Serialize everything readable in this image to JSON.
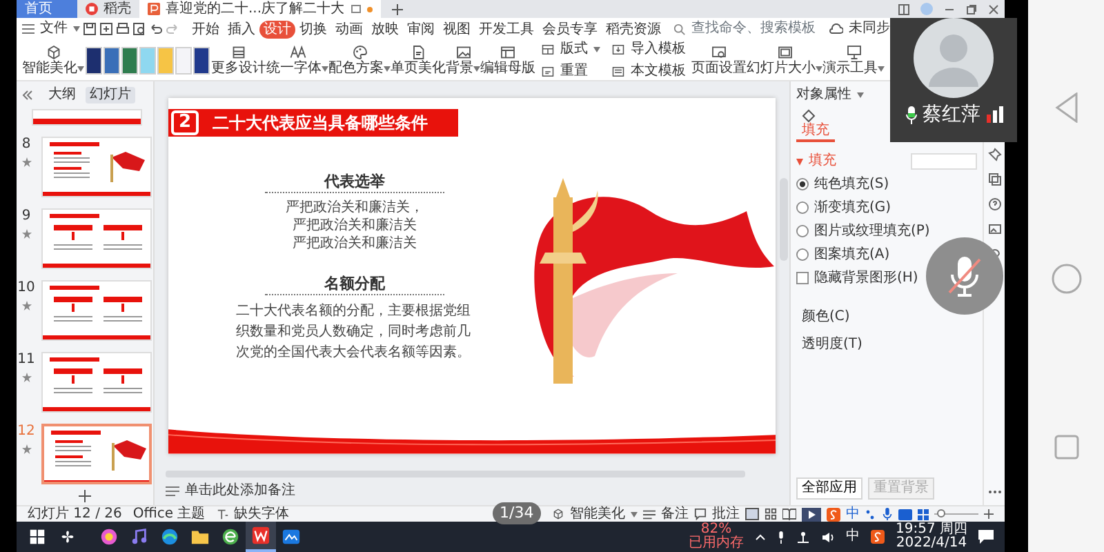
{
  "title_tabs": [
    {
      "label": "首页",
      "kind": "home",
      "selected": false
    },
    {
      "label": "稻壳",
      "kind": "docer",
      "selected": false
    },
    {
      "label": "喜迎党的二十...庆了解二十大",
      "kind": "presentation",
      "selected": true
    }
  ],
  "menu": {
    "file": "文件",
    "tabs": [
      {
        "label": "开始",
        "selected": false
      },
      {
        "label": "插入",
        "selected": false
      },
      {
        "label": "设计",
        "selected": true
      },
      {
        "label": "切换",
        "selected": false
      },
      {
        "label": "动画",
        "selected": false
      },
      {
        "label": "放映",
        "selected": false
      },
      {
        "label": "审阅",
        "selected": false
      },
      {
        "label": "视图",
        "selected": false
      },
      {
        "label": "开发工具",
        "selected": false
      },
      {
        "label": "会员专享",
        "selected": false
      },
      {
        "label": "稻壳资源",
        "selected": false
      }
    ],
    "search": {
      "placeholder": "查找命令、搜索模板"
    },
    "sync": "未同步"
  },
  "ribbon": {
    "items": [
      {
        "kind": "beautify",
        "label": "智能美化",
        "dropdown": true
      },
      {
        "kind": "templates",
        "templates": [
          {
            "color": "#1d2f6f"
          },
          {
            "color": "#3a6fb8"
          },
          {
            "color": "#2f7d4f"
          },
          {
            "color": "#8fd8f0"
          },
          {
            "color": "#f6c445"
          },
          {
            "color": "#f4f4f8"
          },
          {
            "color": "#213a8c"
          }
        ]
      },
      {
        "kind": "more",
        "label": "更多设计",
        "dropdown": false
      },
      {
        "kind": "font",
        "label": "统一字体",
        "dropdown": true
      },
      {
        "kind": "palette",
        "label": "配色方案",
        "dropdown": true
      },
      {
        "kind": "page",
        "label": "单页美化",
        "dropdown": false
      },
      {
        "kind": "background",
        "label": "背景",
        "dropdown": true
      },
      {
        "kind": "master",
        "label": "编辑母版",
        "dropdown": false
      },
      {
        "kind": "pair",
        "items": [
          {
            "kind": "layout",
            "label": "版式",
            "dropdown": true
          },
          {
            "kind": "reset",
            "label": "重置",
            "dropdown": false
          }
        ]
      },
      {
        "kind": "pair",
        "items": [
          {
            "kind": "import",
            "label": "导入模板",
            "dropdown": false
          },
          {
            "kind": "template",
            "label": "本文模板",
            "dropdown": false
          }
        ]
      },
      {
        "kind": "setup",
        "label": "页面设置",
        "dropdown": false
      },
      {
        "kind": "size",
        "label": "幻灯片大小",
        "dropdown": true
      },
      {
        "kind": "present",
        "label": "演示工具",
        "dropdown": true
      }
    ]
  },
  "slide_panel": {
    "tabs": [
      {
        "label": "大纲",
        "selected": false
      },
      {
        "label": "幻灯片",
        "selected": true
      }
    ],
    "slides": [
      {
        "kind": "cut",
        "selected": false
      },
      {
        "number": "8",
        "kind": "flag",
        "selected": false
      },
      {
        "number": "9",
        "kind": "columns",
        "selected": false
      },
      {
        "number": "10",
        "kind": "columns",
        "selected": false
      },
      {
        "number": "11",
        "kind": "columns",
        "selected": false
      },
      {
        "number": "12",
        "kind": "flag",
        "selected": true
      }
    ]
  },
  "slide": {
    "number": "2",
    "title": "二十大代表应当具备哪些条件",
    "sections": [
      {
        "kind": "lines",
        "heading": "代表选举",
        "lines": [
          "严把政治关和廉洁关，",
          "严把政治关和廉洁关",
          "严把政治关和廉洁关"
        ]
      },
      {
        "kind": "paragraph",
        "heading": "名额分配",
        "text": "二十大代表名额的分配，主要根据党组织数量和党员人数确定，同时考虑前几次党的全国代表大会代表名额等因素。"
      }
    ]
  },
  "notes": {
    "placeholder": "单击此处添加备注"
  },
  "properties": {
    "title": "对象属性",
    "tabs": [
      {
        "label": "填充",
        "selected": true
      }
    ],
    "section": "填充",
    "options": [
      {
        "kind": "radio",
        "label": "纯色填充(S)",
        "checked": true
      },
      {
        "kind": "radio",
        "label": "渐变填充(G)",
        "checked": false
      },
      {
        "kind": "radio",
        "label": "图片或纹理填充(P)",
        "checked": false
      },
      {
        "kind": "radio",
        "label": "图案填充(A)",
        "checked": false
      },
      {
        "kind": "checkbox",
        "label": "隐藏背景图形(H)",
        "checked": false
      }
    ],
    "color_label": "颜色(C)",
    "transparency_label": "透明度(T)",
    "buttons": [
      {
        "label": "全部应用",
        "disabled": false
      },
      {
        "label": "重置背景",
        "disabled": true
      }
    ]
  },
  "status_bar": {
    "slide_counter": "幻灯片 12 / 26",
    "theme": "Office 主题",
    "missing_font": "缺失字体",
    "beautify": "智能美化",
    "notes": "备注",
    "comments": "批注",
    "ime": "中",
    "zoom": {
      "level": 0.05
    }
  },
  "page_indicator": "1/34",
  "video_call": {
    "name": "蔡红萍"
  },
  "taskbar": {
    "apps": [
      {
        "kind": "start",
        "active": false
      },
      {
        "kind": "fan",
        "active": false
      },
      {
        "kind": "ring",
        "active": false
      },
      {
        "kind": "music",
        "active": false
      },
      {
        "kind": "wave",
        "active": false
      },
      {
        "kind": "folder",
        "active": false
      },
      {
        "kind": "globe",
        "active": false
      },
      {
        "kind": "doc",
        "active": true
      },
      {
        "kind": "board",
        "active": false
      }
    ],
    "memory_percent": "82%",
    "memory_label": "已用内存",
    "ime": "中",
    "time": "19:57 周四",
    "date": "2022/4/14"
  }
}
